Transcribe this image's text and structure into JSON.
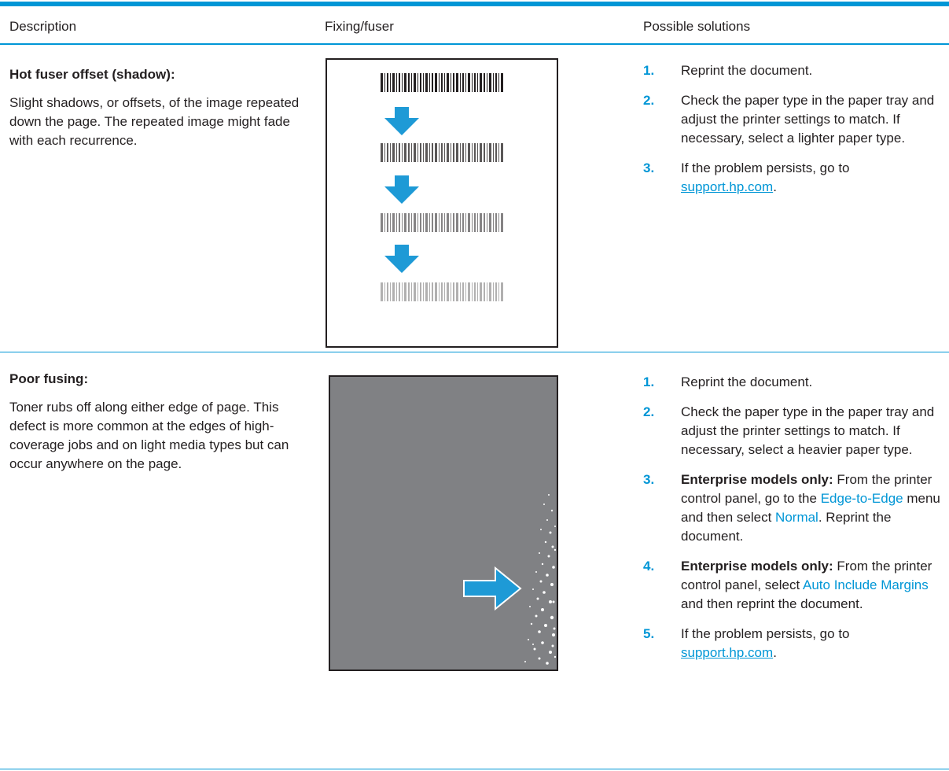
{
  "header": {
    "description": "Description",
    "fixing": "Fixing/fuser",
    "solutions": "Possible solutions"
  },
  "colors": {
    "accent": "#0096d6",
    "page_grey": "#808184",
    "text": "#231f20"
  },
  "rows": [
    {
      "title": "Hot fuser offset (shadow):",
      "description": "Slight shadows, or offsets, of the image repeated down the page. The repeated image might fade with each recurrence.",
      "illustration": {
        "barcode_opacity": [
          1.0,
          0.75,
          0.55,
          0.35
        ],
        "icon": "arrow-down-icon"
      },
      "steps": [
        {
          "num": "1.",
          "text": "Reprint the document."
        },
        {
          "num": "2.",
          "text": "Check the paper type in the paper tray and adjust the printer settings to match. If necessary, select a lighter paper type."
        },
        {
          "num": "3.",
          "text_before": "If the problem persists, go to",
          "link": "support.hp.com",
          "text_after": "."
        }
      ]
    },
    {
      "title": "Poor fusing:",
      "description": "Toner rubs off along either edge of page. This defect is more common at the edges of high-coverage jobs and on light media types but can occur anywhere on the page.",
      "illustration": {
        "icon": "arrow-right-icon"
      },
      "steps": [
        {
          "num": "1.",
          "text": "Reprint the document."
        },
        {
          "num": "2.",
          "text": "Check the paper type in the paper tray and adjust the printer settings to match. If necessary, select a heavier paper type."
        },
        {
          "num": "3.",
          "bold": "Enterprise models only:",
          "text_a": "From the printer control panel, go to the",
          "ui_a": "Edge-to-Edge",
          "text_b": "menu and then select",
          "ui_b": "Normal",
          "text_c": ". Reprint the document."
        },
        {
          "num": "4.",
          "bold": "Enterprise models only:",
          "text_a": "From the printer control panel, select",
          "ui_a": "Auto Include Margins",
          "text_b": "and then reprint the document."
        },
        {
          "num": "5.",
          "text_before": "If the problem persists, go to",
          "link": "support.hp.com",
          "text_after": "."
        }
      ]
    }
  ]
}
